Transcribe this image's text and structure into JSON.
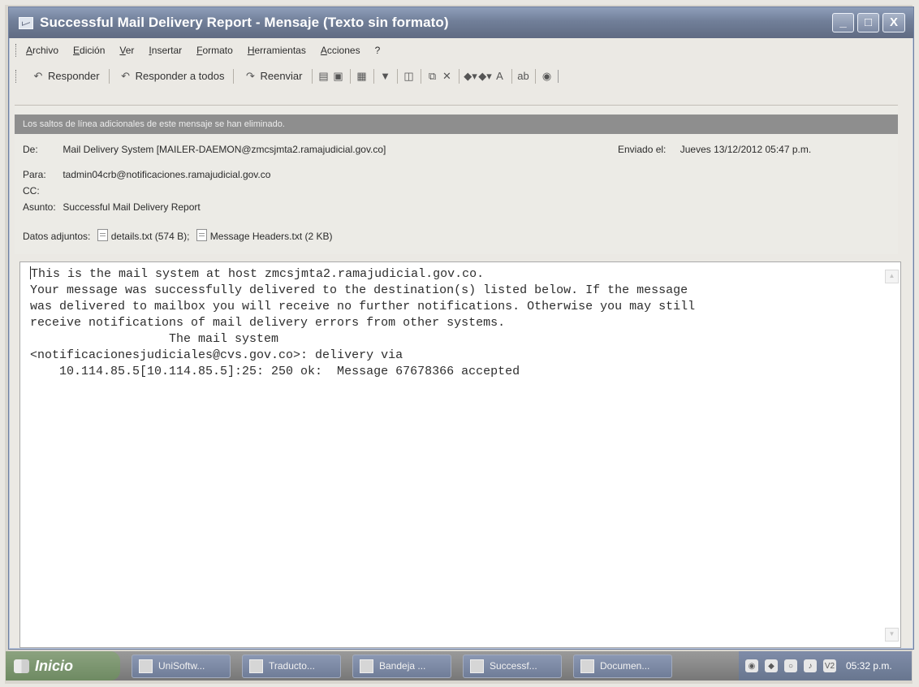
{
  "window": {
    "title": "Successful Mail Delivery Report - Mensaje (Texto sin formato)",
    "controls": {
      "minimize": "_",
      "maximize": "□",
      "close": "X"
    }
  },
  "menu": [
    "Archivo",
    "Edición",
    "Ver",
    "Insertar",
    "Formato",
    "Herramientas",
    "Acciones",
    "?"
  ],
  "toolbar": {
    "reply": "Responder",
    "reply_all": "Responder a todos",
    "forward": "Reenviar",
    "font_size": "A",
    "translate": "ab"
  },
  "message": {
    "info_bar": "Los saltos de línea adicionales de este mensaje se han eliminado.",
    "labels": {
      "from": "De:",
      "to": "Para:",
      "cc": "CC:",
      "subject": "Asunto:",
      "sent": "Enviado el:",
      "attachments": "Datos adjuntos:"
    },
    "from": "Mail Delivery System [MAILER-DAEMON@zmcsjmta2.ramajudicial.gov.co]",
    "to": "tadmin04crb@notificaciones.ramajudicial.gov.co",
    "cc": "",
    "subject": "Successful Mail Delivery Report",
    "sent": "Jueves 13/12/2012 05:47 p.m.",
    "attachments": [
      {
        "name": "details.txt (574 B);"
      },
      {
        "name": "Message Headers.txt (2 KB)"
      }
    ],
    "body_lines": [
      "This is the mail system at host zmcsjmta2.ramajudicial.gov.co.",
      "",
      "Your message was successfully delivered to the destination(s) listed below. If the message",
      "was delivered to mailbox you will receive no further notifications. Otherwise you may still",
      "receive notifications of mail delivery errors from other systems.",
      "",
      "                   The mail system",
      "",
      "<notificacionesjudiciales@cvs.gov.co>: delivery via",
      "    10.114.85.5[10.114.85.5]:25: 250 ok:  Message 67678366 accepted"
    ]
  },
  "taskbar": {
    "start": "Inicio",
    "items": [
      "UniSoftw...",
      "Traducto...",
      "Bandeja ...",
      "Successf...",
      "Documen..."
    ],
    "tray_badge": "V2",
    "clock": "05:32 p.m."
  }
}
